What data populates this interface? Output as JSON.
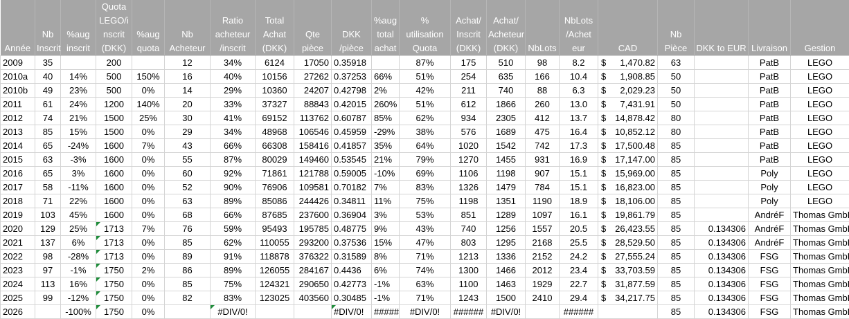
{
  "headers": [
    "Année",
    "Nb\nInscrit",
    "%aug\ninscrit",
    "Quota\nLEGO/i\nnscrit\n(DKK)",
    "%aug\nquota",
    "Nb\nAcheteur",
    "Ratio\nacheteur\n/inscrit",
    "Total\nAchat\n(DKK)",
    "Qte\npièce",
    "DKK\n/pièce",
    "%aug\ntotal\nachat",
    "%\nutilisation\nQuota",
    "Achat/\nInscrit\n(DKK)",
    "Achat/\nAcheteur\n(DKK)",
    "NbLots",
    "NbLots\n/Achet\neur",
    "CAD",
    "Nb\nPièce",
    "DKK to EUR",
    "Livraison",
    "Gestion"
  ],
  "rows": [
    [
      "2009",
      "35",
      "",
      "200",
      "",
      "12",
      "34%",
      "6124",
      "17050",
      "0.35918",
      "",
      "87%",
      "175",
      "510",
      "98",
      "8.2",
      "1,470.82",
      "63",
      "",
      "PatB",
      "LEGO"
    ],
    [
      "2010a",
      "40",
      "14%",
      "500",
      "150%",
      "16",
      "40%",
      "10156",
      "27262",
      "0.37253",
      "66%",
      "51%",
      "254",
      "635",
      "166",
      "10.4",
      "1,908.85",
      "50",
      "",
      "PatB",
      "LEGO"
    ],
    [
      "2010b",
      "49",
      "23%",
      "500",
      "0%",
      "14",
      "29%",
      "10360",
      "24207",
      "0.42798",
      "2%",
      "42%",
      "211",
      "740",
      "88",
      "6.3",
      "2,029.23",
      "50",
      "",
      "PatB",
      "LEGO"
    ],
    [
      "2011",
      "61",
      "24%",
      "1200",
      "140%",
      "20",
      "33%",
      "37327",
      "88843",
      "0.42015",
      "260%",
      "51%",
      "612",
      "1866",
      "260",
      "13.0",
      "7,431.91",
      "50",
      "",
      "PatB",
      "LEGO"
    ],
    [
      "2012",
      "74",
      "21%",
      "1500",
      "25%",
      "30",
      "41%",
      "69152",
      "113762",
      "0.60787",
      "85%",
      "62%",
      "934",
      "2305",
      "412",
      "13.7",
      "14,878.42",
      "80",
      "",
      "PatB",
      "LEGO"
    ],
    [
      "2013",
      "85",
      "15%",
      "1500",
      "0%",
      "29",
      "34%",
      "48968",
      "106546",
      "0.45959",
      "-29%",
      "38%",
      "576",
      "1689",
      "475",
      "16.4",
      "10,852.12",
      "80",
      "",
      "PatB",
      "LEGO"
    ],
    [
      "2014",
      "65",
      "-24%",
      "1600",
      "7%",
      "43",
      "66%",
      "66308",
      "158416",
      "0.41857",
      "35%",
      "64%",
      "1020",
      "1542",
      "742",
      "17.3",
      "17,500.48",
      "85",
      "",
      "PatB",
      "LEGO"
    ],
    [
      "2015",
      "63",
      "-3%",
      "1600",
      "0%",
      "55",
      "87%",
      "80029",
      "149460",
      "0.53545",
      "21%",
      "79%",
      "1270",
      "1455",
      "931",
      "16.9",
      "17,147.00",
      "85",
      "",
      "PatB",
      "LEGO"
    ],
    [
      "2016",
      "65",
      "3%",
      "1600",
      "0%",
      "60",
      "92%",
      "71861",
      "121788",
      "0.59005",
      "-10%",
      "69%",
      "1106",
      "1198",
      "907",
      "15.1",
      "15,969.00",
      "85",
      "",
      "Poly",
      "LEGO"
    ],
    [
      "2017",
      "58",
      "-11%",
      "1600",
      "0%",
      "52",
      "90%",
      "76906",
      "109581",
      "0.70182",
      "7%",
      "83%",
      "1326",
      "1479",
      "784",
      "15.1",
      "16,823.00",
      "85",
      "",
      "Poly",
      "LEGO"
    ],
    [
      "2018",
      "71",
      "22%",
      "1600",
      "0%",
      "63",
      "89%",
      "85086",
      "244426",
      "0.34811",
      "11%",
      "75%",
      "1198",
      "1351",
      "1190",
      "18.9",
      "18,106.00",
      "85",
      "",
      "Poly",
      "LEGO"
    ],
    [
      "2019",
      "103",
      "45%",
      "1600",
      "0%",
      "68",
      "66%",
      "87685",
      "237600",
      "0.36904",
      "3%",
      "53%",
      "851",
      "1289",
      "1097",
      "16.1",
      "19,861.79",
      "85",
      "",
      "AndréF",
      "Thomas GmbH"
    ],
    [
      "2020",
      "129",
      "25%",
      "1713",
      "7%",
      "76",
      "59%",
      "95493",
      "195785",
      "0.48775",
      "9%",
      "43%",
      "740",
      "1256",
      "1557",
      "20.5",
      "26,423.55",
      "85",
      "0.134306",
      "AndréF",
      "Thomas GmbH"
    ],
    [
      "2021",
      "137",
      "6%",
      "1713",
      "0%",
      "85",
      "62%",
      "110055",
      "293200",
      "0.37536",
      "15%",
      "47%",
      "803",
      "1295",
      "2168",
      "25.5",
      "28,529.50",
      "85",
      "0.134306",
      "AndréF",
      "Thomas GmbH"
    ],
    [
      "2022",
      "98",
      "-28%",
      "1713",
      "0%",
      "89",
      "91%",
      "118878",
      "376322",
      "0.31589",
      "8%",
      "71%",
      "1213",
      "1336",
      "2152",
      "24.2",
      "27,555.24",
      "85",
      "0.134306",
      "FSG",
      "Thomas GmbH"
    ],
    [
      "2023",
      "97",
      "-1%",
      "1750",
      "2%",
      "86",
      "89%",
      "126055",
      "284167",
      "0.4436",
      "6%",
      "74%",
      "1300",
      "1466",
      "2012",
      "23.4",
      "33,703.59",
      "85",
      "0.134306",
      "FSG",
      "Thomas GmbH"
    ],
    [
      "2024",
      "113",
      "16%",
      "1750",
      "0%",
      "85",
      "75%",
      "124321",
      "290650",
      "0.42773",
      "-1%",
      "63%",
      "1100",
      "1463",
      "1929",
      "22.7",
      "31,877.59",
      "85",
      "0.134306",
      "FSG",
      "Thomas GmbH"
    ],
    [
      "2025",
      "99",
      "-12%",
      "1750",
      "0%",
      "82",
      "83%",
      "123025",
      "403560",
      "0.30485",
      "-1%",
      "71%",
      "1243",
      "1500",
      "2410",
      "29.4",
      "34,217.75",
      "85",
      "0.134306",
      "FSG",
      "Thomas GmbH"
    ],
    [
      "2026",
      "",
      "-100%",
      "1750",
      "0%",
      "",
      "#DIV/0!",
      "",
      "",
      "#DIV/0!",
      "#####",
      "#DIV/0!",
      "######",
      "#DIV/0!",
      "",
      "######",
      "",
      "85",
      "0.134306",
      "FSG",
      "Thomas GmbH"
    ]
  ],
  "currency_symbol": "$",
  "warning_marker_color": "#1e8c3a",
  "header_bg": "#a6a6a6"
}
